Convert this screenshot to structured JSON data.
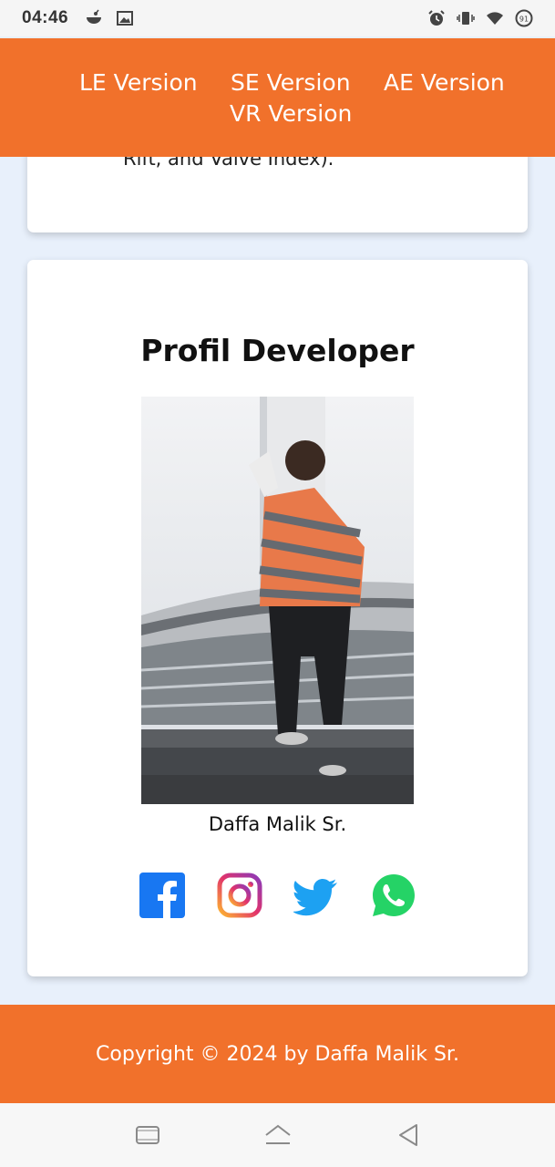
{
  "status_bar": {
    "time": "04:46",
    "left_icons": [
      "notification-app-icon",
      "gallery-icon"
    ],
    "right_icons": [
      "alarm-icon",
      "vibrate-icon",
      "wifi-icon",
      "battery-icon"
    ],
    "battery_level": "91"
  },
  "nav": {
    "links": [
      "LE Version",
      "SE Version",
      "AE Version",
      "VR Version"
    ],
    "background_color": "#f1712b"
  },
  "top_card": {
    "partial_text": "Rift, and Valve Index)."
  },
  "profile": {
    "title": "Profil Developer",
    "photo_alt": "developer-photo",
    "name": "Daffa Malik Sr.",
    "social": [
      {
        "name": "facebook-icon",
        "color": "#1877f2"
      },
      {
        "name": "instagram-icon",
        "color": "#e1306c"
      },
      {
        "name": "twitter-icon",
        "color": "#1da1f2"
      },
      {
        "name": "whatsapp-icon",
        "color": "#25d366"
      }
    ]
  },
  "footer": {
    "copyright": "Copyright © 2024 by Daffa Malik Sr."
  },
  "android_nav": [
    "recents-button",
    "home-button",
    "back-button"
  ]
}
